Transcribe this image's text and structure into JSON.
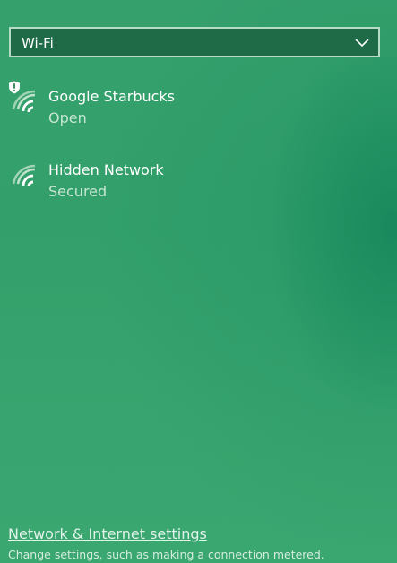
{
  "adapter": {
    "selected": "Wi-Fi",
    "icon": "chevron-down-icon"
  },
  "networks": [
    {
      "name": "Google Starbucks",
      "status": "Open",
      "icon": "wifi-signal-icon",
      "warning_icon": "shield-warning-icon"
    },
    {
      "name": "Hidden Network",
      "status": "Secured",
      "icon": "wifi-signal-icon"
    }
  ],
  "footer": {
    "link_label": "Network & Internet settings",
    "description": "Change settings, such as making a connection metered."
  },
  "colors": {
    "background": "#35a06c",
    "dropdown_fill": "#1f6b48",
    "dropdown_border": "#b6dcc5",
    "status_text": "#c6e6d3"
  }
}
